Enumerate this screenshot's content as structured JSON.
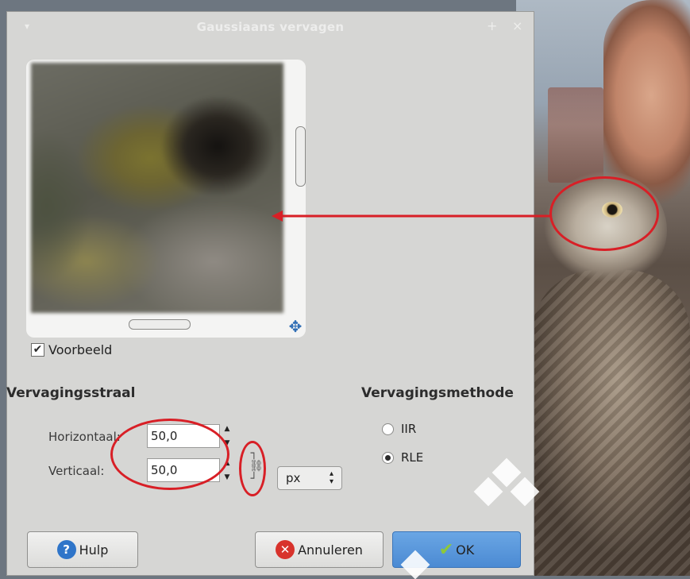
{
  "dialog": {
    "title": "Gaussiaans vervagen",
    "preview_checkbox_label": "Voorbeeld",
    "preview_checked": true
  },
  "blur_radius": {
    "section_title": "Vervagingsstraal",
    "horizontal_label": "Horizontaal:",
    "horizontal_value": "50,0",
    "vertical_label": "Verticaal:",
    "vertical_value": "50,0",
    "unit": "px",
    "chain_linked": true
  },
  "blur_method": {
    "section_title": "Vervagingsmethode",
    "options": [
      {
        "label": "IIR",
        "selected": false
      },
      {
        "label": "RLE",
        "selected": true
      }
    ]
  },
  "buttons": {
    "help": "Hulp",
    "cancel": "Annuleren",
    "ok": "OK"
  },
  "colors": {
    "annotation": "#d81f26",
    "ok_button": "#4b8ad3",
    "help_icon": "#2f75c9",
    "cancel_icon": "#d8332c",
    "ok_check": "#8ec83a"
  }
}
